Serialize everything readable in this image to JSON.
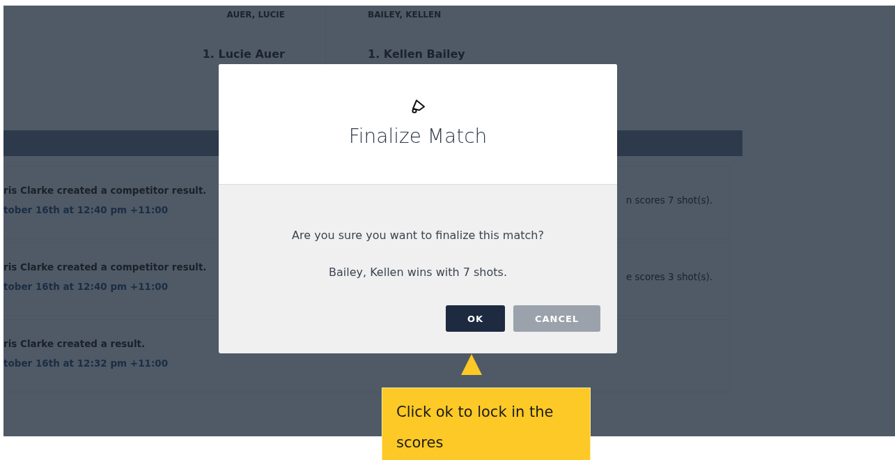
{
  "players": [
    {
      "heading": "AUER, LUCIE",
      "name": "1. Lucie Auer"
    },
    {
      "heading": "BAILEY, KELLEN",
      "name": "1. Kellen Bailey"
    }
  ],
  "activity": [
    {
      "text": "ris Clarke created a competitor result.",
      "time": "tober 16th at 12:40 pm +11:00",
      "detail": "n scores 7 shot(s)."
    },
    {
      "text": "ris Clarke created a competitor result.",
      "time": "tober 16th at 12:40 pm +11:00",
      "detail": "e scores 3 shot(s)."
    },
    {
      "text": "ris Clarke created a result.",
      "time": "tober 16th at 12:32 pm +11:00"
    }
  ],
  "dialog": {
    "title": "Finalize Match",
    "message": "Are you sure you want to finalize this match?",
    "result": "Bailey, Kellen wins with 7 shots.",
    "buttons": [
      {
        "label": "OK",
        "kind": "primary"
      },
      {
        "label": "CANCEL",
        "kind": "secondary"
      }
    ]
  },
  "tooltip": {
    "text": "Click ok to lock in the scores"
  }
}
